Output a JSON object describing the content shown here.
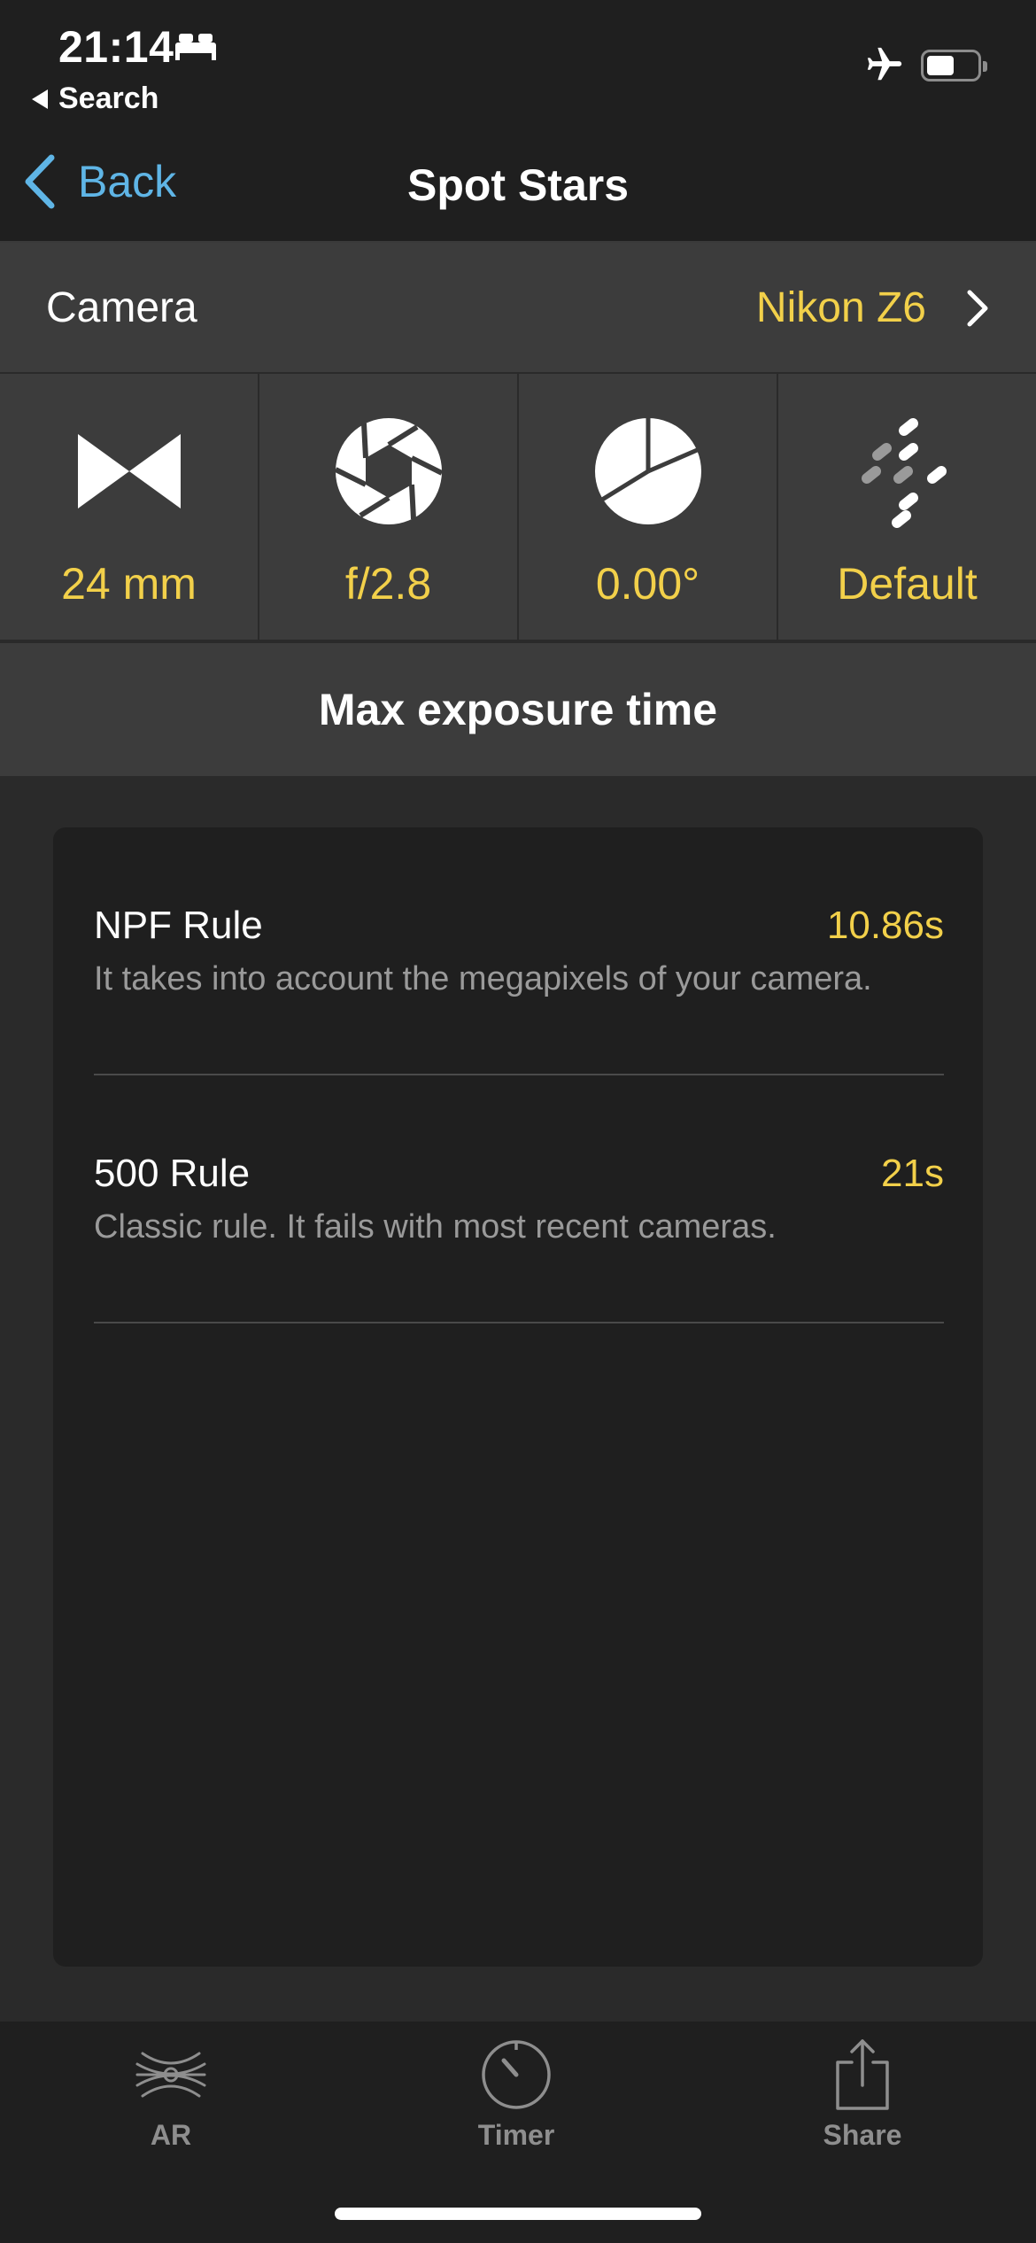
{
  "status_bar": {
    "time": "21:14",
    "back_app_label": "Search"
  },
  "nav": {
    "back_label": "Back",
    "title": "Spot Stars"
  },
  "camera": {
    "label": "Camera",
    "value": "Nikon Z6"
  },
  "settings": [
    {
      "icon": "focal-length-icon",
      "value": "24 mm"
    },
    {
      "icon": "aperture-icon",
      "value": "f/2.8"
    },
    {
      "icon": "declination-pie-icon",
      "value": "0.00°"
    },
    {
      "icon": "accuracy-dots-icon",
      "value": "Default"
    }
  ],
  "section": {
    "title": "Max exposure time"
  },
  "rules": [
    {
      "name": "NPF Rule",
      "value": "10.86s",
      "description": "It takes into account the megapixels of your camera."
    },
    {
      "name": "500 Rule",
      "value": "21s",
      "description": "Classic rule. It fails with most recent cameras."
    }
  ],
  "tabs": [
    {
      "icon": "ar-icon",
      "label": "AR"
    },
    {
      "icon": "timer-icon",
      "label": "Timer"
    },
    {
      "icon": "share-icon",
      "label": "Share"
    }
  ],
  "colors": {
    "accent_yellow": "#f2d04a",
    "link_blue": "#5fb5e6",
    "background": "#2a2a2a",
    "panel": "#3c3c3c",
    "card": "#1f1f1f"
  }
}
